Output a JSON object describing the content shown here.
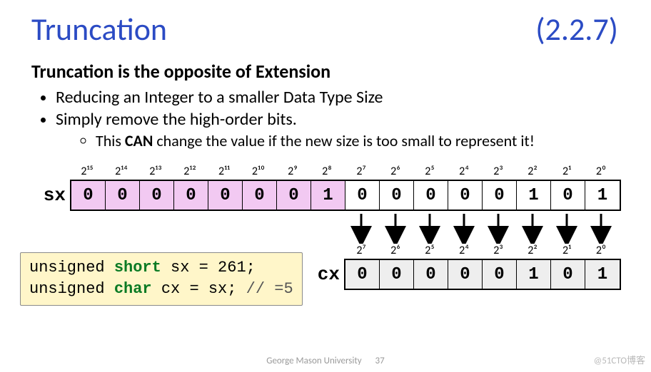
{
  "title": "Truncation",
  "section_ref": "(2.2.7)",
  "subtitle": "Truncation is the opposite of Extension",
  "bullets": {
    "b1": "Reducing an Integer to a smaller Data Type Size",
    "b2": "Simply remove the high-order bits.",
    "sub1_a": "This ",
    "sub1_b": "CAN",
    "sub1_c": " change the value if the new size is too small to represent it!"
  },
  "sx": {
    "label": "sx",
    "powers": [
      "2¹⁵",
      "2¹⁴",
      "2¹³",
      "2¹²",
      "2¹¹",
      "2¹⁰",
      "2⁹",
      "2⁸",
      "2⁷",
      "2⁶",
      "2⁵",
      "2⁴",
      "2³",
      "2²",
      "2¹",
      "2⁰"
    ],
    "bits": [
      "0",
      "0",
      "0",
      "0",
      "0",
      "0",
      "0",
      "1",
      "0",
      "0",
      "0",
      "0",
      "0",
      "1",
      "0",
      "1"
    ]
  },
  "cx": {
    "label": "cx",
    "powers": [
      "2⁷",
      "2⁶",
      "2⁵",
      "2⁴",
      "2³",
      "2²",
      "2¹",
      "2⁰"
    ],
    "bits": [
      "0",
      "0",
      "0",
      "0",
      "0",
      "1",
      "0",
      "1"
    ]
  },
  "code": {
    "l1_a": "unsigned ",
    "l1_type": "short",
    "l1_b": " sx = 261;",
    "l2_a": "unsigned ",
    "l2_type": "char",
    "l2_b": "  cx = sx; ",
    "l2_cmt": "// =5"
  },
  "footer": "George Mason University",
  "watermark": "@51CTO博客",
  "page_no": "37"
}
